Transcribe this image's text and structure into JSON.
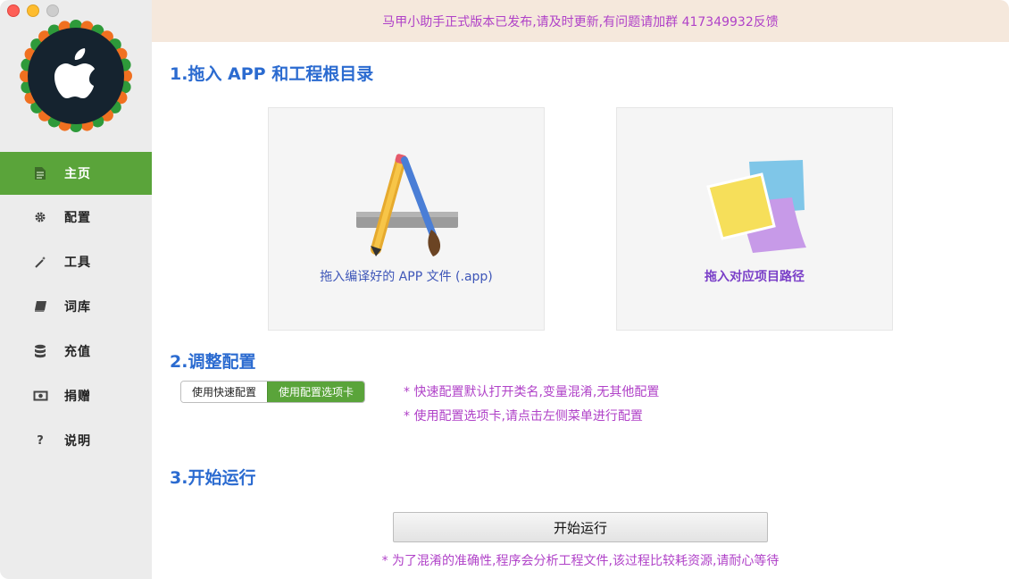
{
  "banner": {
    "text": "马甲小助手正式版本已发布,请及时更新,有问题请加群 417349932反馈"
  },
  "sidebar": {
    "logo_icon": "apple-logo",
    "items": [
      {
        "label": "主页",
        "icon": "document-icon",
        "active": true
      },
      {
        "label": "配置",
        "icon": "gear-icon",
        "active": false
      },
      {
        "label": "工具",
        "icon": "magic-wand-icon",
        "active": false
      },
      {
        "label": "词库",
        "icon": "book-icon",
        "active": false
      },
      {
        "label": "充值",
        "icon": "database-icon",
        "active": false
      },
      {
        "label": "捐赠",
        "icon": "money-icon",
        "active": false
      },
      {
        "label": "说明",
        "icon": "question-icon",
        "active": false
      }
    ]
  },
  "main": {
    "section1": {
      "title": "1.拖入 APP 和工程根目录",
      "app_drop_label": "拖入编译好的 APP 文件 (.app)",
      "project_drop_label": "拖入对应项目路径"
    },
    "section2": {
      "title": "2.调整配置",
      "segments": [
        "使用快速配置",
        "使用配置选项卡"
      ],
      "selected_segment": 1,
      "notes": [
        "* 快速配置默认打开类名,变量混淆,无其他配置",
        "* 使用配置选项卡,请点击左侧菜单进行配置"
      ]
    },
    "section3": {
      "title": "3.开始运行",
      "run_button": "开始运行",
      "note": "* 为了混淆的准确性,程序会分析工程文件,该过程比较耗资源,请耐心等待"
    }
  },
  "colors": {
    "accent_green": "#5aa43a",
    "title_blue": "#2b6bd0",
    "note_purple": "#b042c8",
    "banner_bg": "#f5e8dc"
  }
}
